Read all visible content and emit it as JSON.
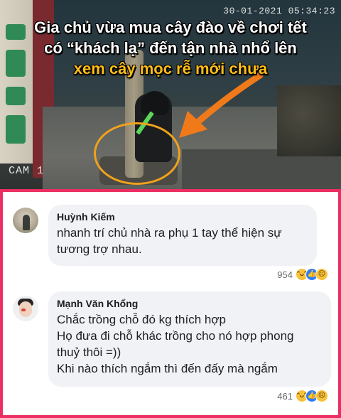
{
  "cctv": {
    "timestamp": "30-01-2021 05:34:23",
    "camera_label": "CAM 1",
    "headline": {
      "line1": "Gia chủ vừa mua cây đào về chơi tết",
      "line2": "có “khách lạ” đến tận nhà nhổ lên",
      "line3": "xem cây mọc rễ mới chưa"
    },
    "colors": {
      "headline_white": "#ffffff",
      "headline_highlight": "#ffbe16",
      "annotation": "#f0a21c"
    }
  },
  "comments_panel": {
    "border_color": "#ed2e63",
    "comments": [
      {
        "author": "Huỳnh Kiếm",
        "avatar_icon": "avatar-photo",
        "lines": [
          "nhanh trí chủ nhà ra phụ 1 tay thể hiện sự",
          "tương trợ nhau."
        ],
        "reaction_count": "954",
        "reaction_icons": [
          "haha-icon",
          "like-icon",
          "sad-icon"
        ]
      },
      {
        "author": "Mạnh Văn Khổng",
        "avatar_icon": "avatar-photo",
        "lines": [
          "Chắc trồng chỗ đó kg thích hợp",
          "Họ đưa đi chỗ khác trồng cho nó hợp phong",
          "thuỷ thôi =))",
          "Khi nào thích ngắm thì đến đấy mà ngắm"
        ],
        "reaction_count": "461",
        "reaction_icons": [
          "haha-icon",
          "like-icon",
          "sad-icon"
        ]
      }
    ]
  }
}
